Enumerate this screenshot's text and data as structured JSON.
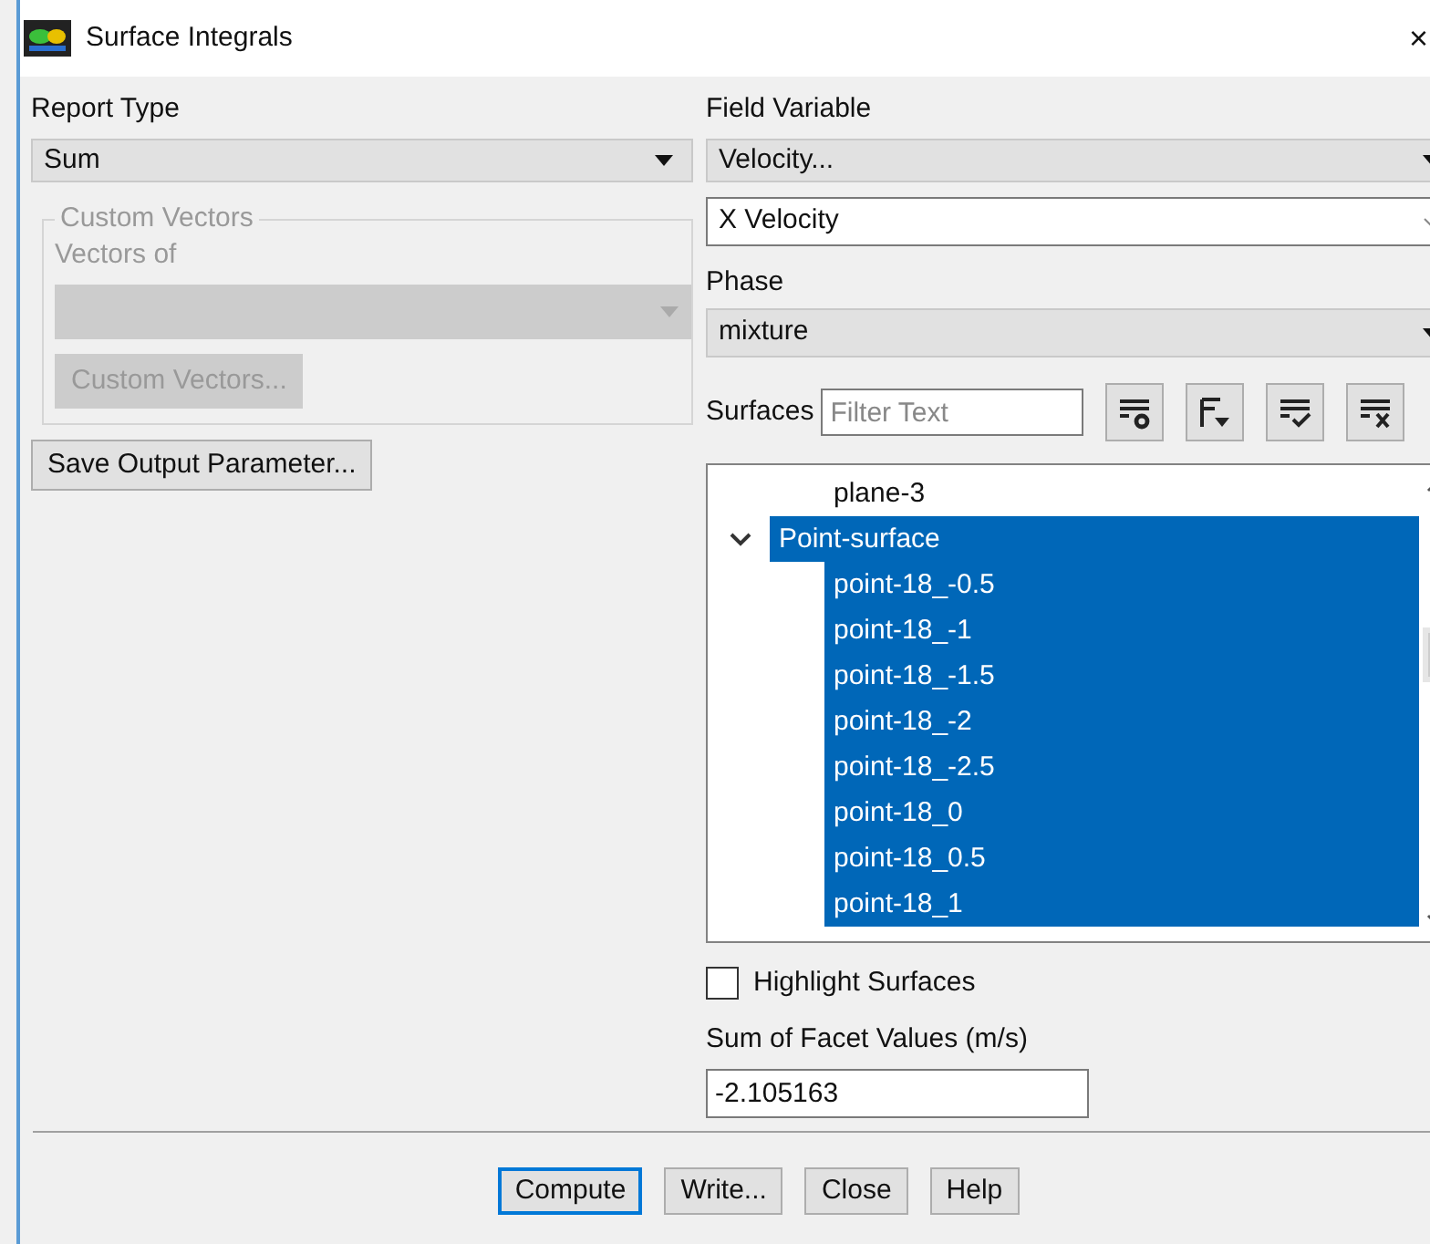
{
  "window": {
    "title": "Surface Integrals",
    "close": "×"
  },
  "report_type": {
    "label": "Report Type",
    "value": "Sum"
  },
  "custom_vectors": {
    "legend": "Custom Vectors",
    "vectors_of_label": "Vectors of",
    "button": "Custom Vectors...",
    "disabled": true
  },
  "save_button": "Save Output Parameter...",
  "field_variable": {
    "label": "Field Variable",
    "category": "Velocity...",
    "value": "X Velocity"
  },
  "phase": {
    "label": "Phase",
    "value": "mixture"
  },
  "surfaces": {
    "label": "Surfaces",
    "placeholder": "Filter Text",
    "tree": [
      {
        "label": "plane-3",
        "selected": false
      },
      {
        "label": "Point-surface",
        "selected": true,
        "expanded": true,
        "children": [
          {
            "label": "point-18_-0.5",
            "selected": true
          },
          {
            "label": "point-18_-1",
            "selected": true
          },
          {
            "label": "point-18_-1.5",
            "selected": true
          },
          {
            "label": "point-18_-2",
            "selected": true
          },
          {
            "label": "point-18_-2.5",
            "selected": true
          },
          {
            "label": "point-18_0",
            "selected": true
          },
          {
            "label": "point-18_0.5",
            "selected": true
          },
          {
            "label": "point-18_1",
            "selected": true
          }
        ]
      }
    ]
  },
  "highlight_surfaces": {
    "label": "Highlight Surfaces",
    "checked": false
  },
  "result": {
    "label": "Sum of Facet Values (m/s)",
    "value": "-2.105163"
  },
  "buttons": [
    {
      "label": "Compute",
      "focused": true
    },
    {
      "label": "Write...",
      "focused": false
    },
    {
      "label": "Close",
      "focused": false
    },
    {
      "label": "Help",
      "focused": false
    }
  ]
}
